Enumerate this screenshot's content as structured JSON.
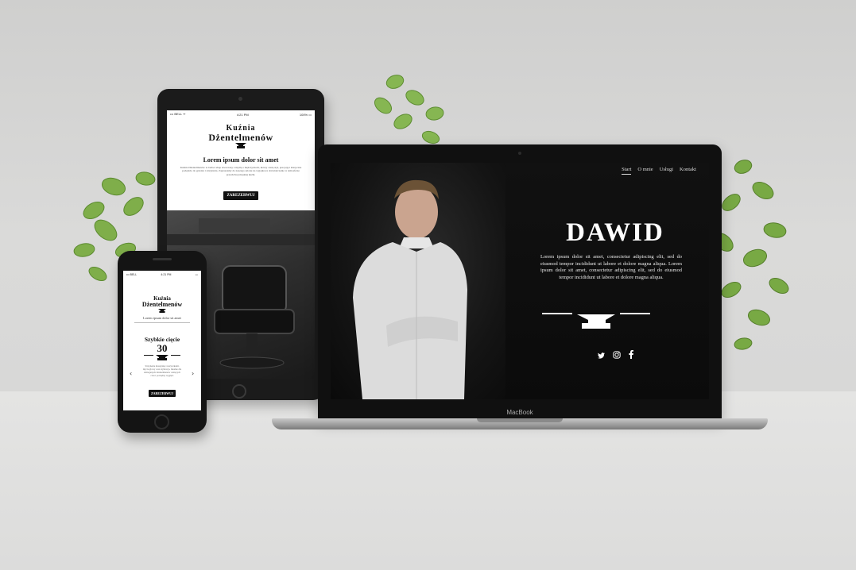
{
  "tablet": {
    "status": {
      "carrier": "••• BELL ᯤ",
      "time": "4:21 PM",
      "battery": "100% ▭"
    },
    "logo": {
      "line1": "Kuźnia",
      "line2": "Dżentelmenów"
    },
    "heading": "Lorem ipsum dolor sit amet",
    "body": "Kuźnia Dżentelmenów to barber shop stworzony z myślą o mężczyznach, którzy cenią styl, precyzję i klasyczne podejście do golenia i strzyżenia. Zapraszamy do naszego salonu na wyjątkowe doświadczenie w atmosferze prawdziwej męskiej kuźni.",
    "button": "ZAREZERWUJ"
  },
  "laptop": {
    "brand": "MacBook",
    "nav": [
      "Start",
      "O mnie",
      "Usługi",
      "Kontakt"
    ],
    "title": "DAWID",
    "text": "Lorem ipsum dolor sit amet, consectetur adipiscing elit, sed do eiusmod tempor incididunt ut labore et dolore magna aliqua. Lorem ipsum dolor sit amet, consectetur adipiscing elit, sed do eiusmod tempor incididunt ut labore et dolore magna aliqua.",
    "social": [
      "twitter-icon",
      "instagram-icon",
      "facebook-icon"
    ]
  },
  "phone": {
    "status": {
      "carrier": "••• BELL",
      "time": "4:21 PM",
      "battery": "▭"
    },
    "logo": {
      "line1": "Kuźnia",
      "line2": "Dżentelmenów"
    },
    "subtitle": "Lorem ipsum dolor sit amet",
    "card_title": "Szybkie cięcie",
    "card_number": "30",
    "card_text": "Strzyżenie maszynką i nożyczkami, mycie głowy oraz stylizacja. Idealne dla zabieganych dżentelmenów ceniących czas i porządny wygląd.",
    "button": "ZAREZERWUJ",
    "arrow_left": "‹",
    "arrow_right": "›"
  },
  "colors": {
    "accent_dark": "#111111",
    "screen_bg": "#0d0d0d",
    "wall": "#d7d7d6"
  }
}
